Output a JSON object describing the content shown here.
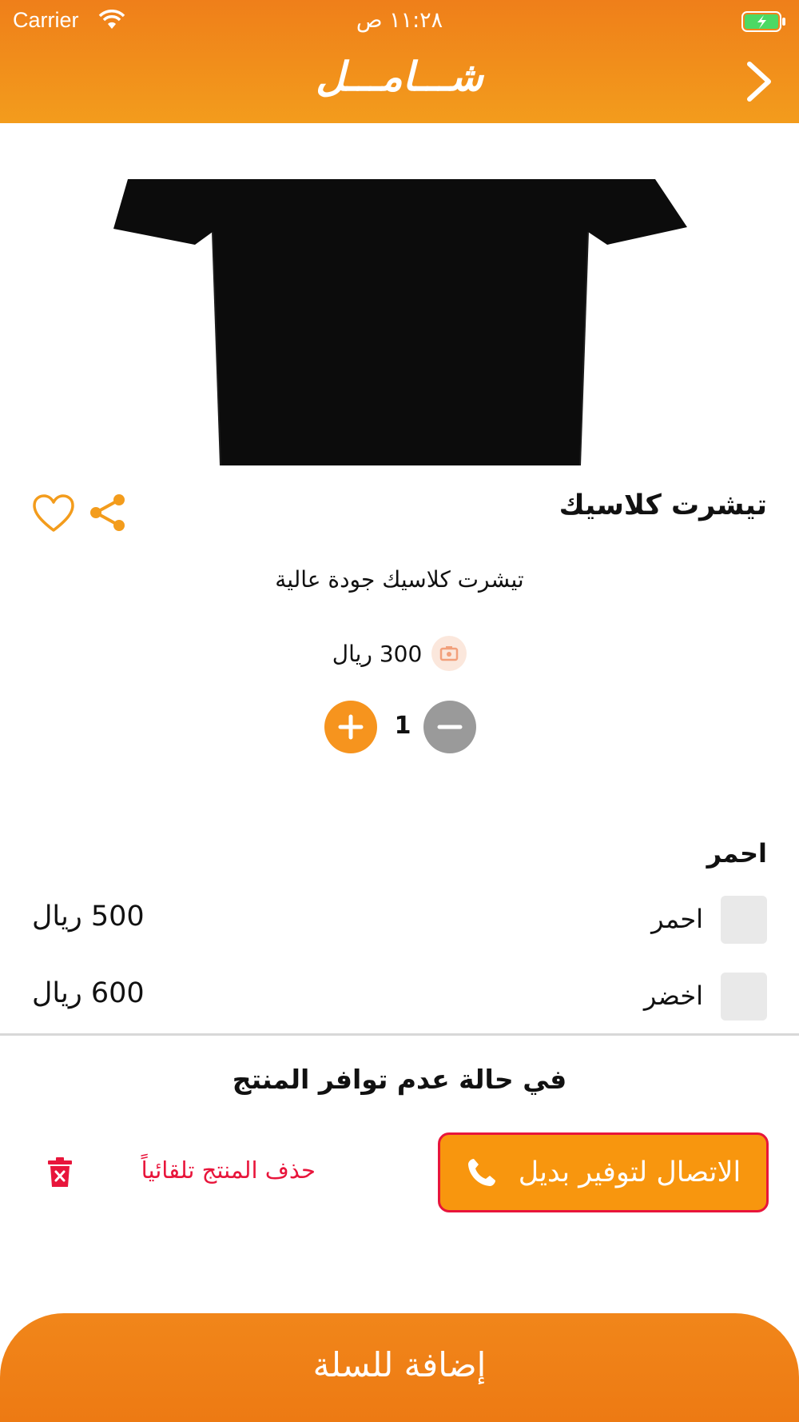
{
  "status_bar": {
    "carrier": "Carrier",
    "time": "١١:٢٨ ص"
  },
  "header": {
    "title": "شـــامـــل"
  },
  "product": {
    "name": "تيشرت كلاسيك",
    "description": "تيشرت كلاسيك جودة عالية",
    "price": "300 ريال",
    "quantity": "1"
  },
  "options": {
    "title": "احمر",
    "items": [
      {
        "label": "احمر",
        "price": "500 ريال"
      },
      {
        "label": "اخضر",
        "price": "600 ريال"
      }
    ]
  },
  "unavailable": {
    "title": "في حالة عدم توافر المنتج",
    "call_label": "الاتصال لتوفير بديل",
    "delete_label": "حذف المنتج تلقائياً"
  },
  "cart": {
    "add_label": "إضافة للسلة"
  },
  "colors": {
    "brand_orange": "#f39c1c",
    "accent_red": "#e8153b",
    "button_orange": "#f8960e"
  }
}
